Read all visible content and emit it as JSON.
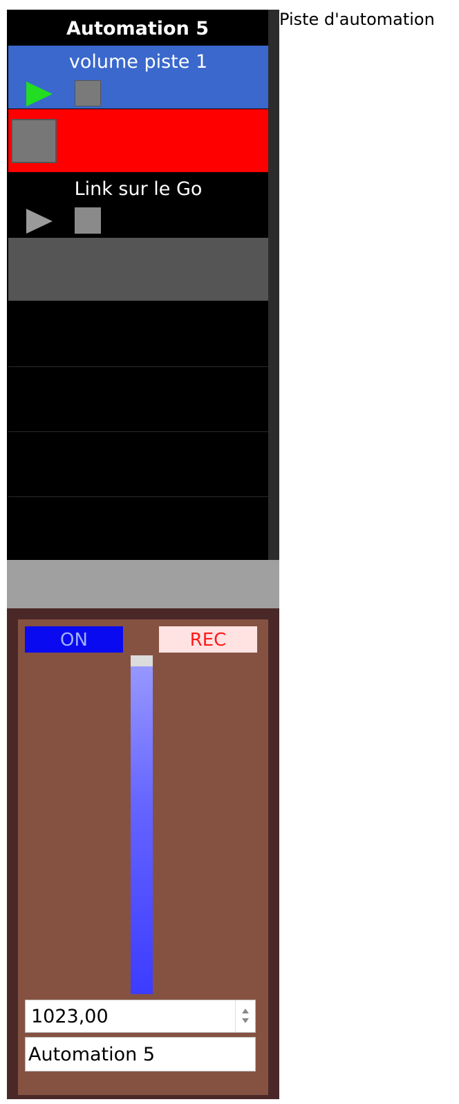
{
  "caption": "Piste d'automation",
  "panel": {
    "title": "Automation  5",
    "slots": [
      {
        "label": "volume piste 1",
        "state": "playing",
        "color": "#3a68cc"
      },
      {
        "label": "",
        "state": "recording",
        "color": "#ff0000"
      },
      {
        "label": "Link sur le Go",
        "state": "idle",
        "color": "#000000"
      },
      {
        "label": "",
        "state": "empty",
        "color": "#555555"
      }
    ]
  },
  "control": {
    "on_label": "ON",
    "rec_label": "REC",
    "slider_level_percent": 100,
    "value": "1023,00",
    "name": "Automation  5"
  }
}
